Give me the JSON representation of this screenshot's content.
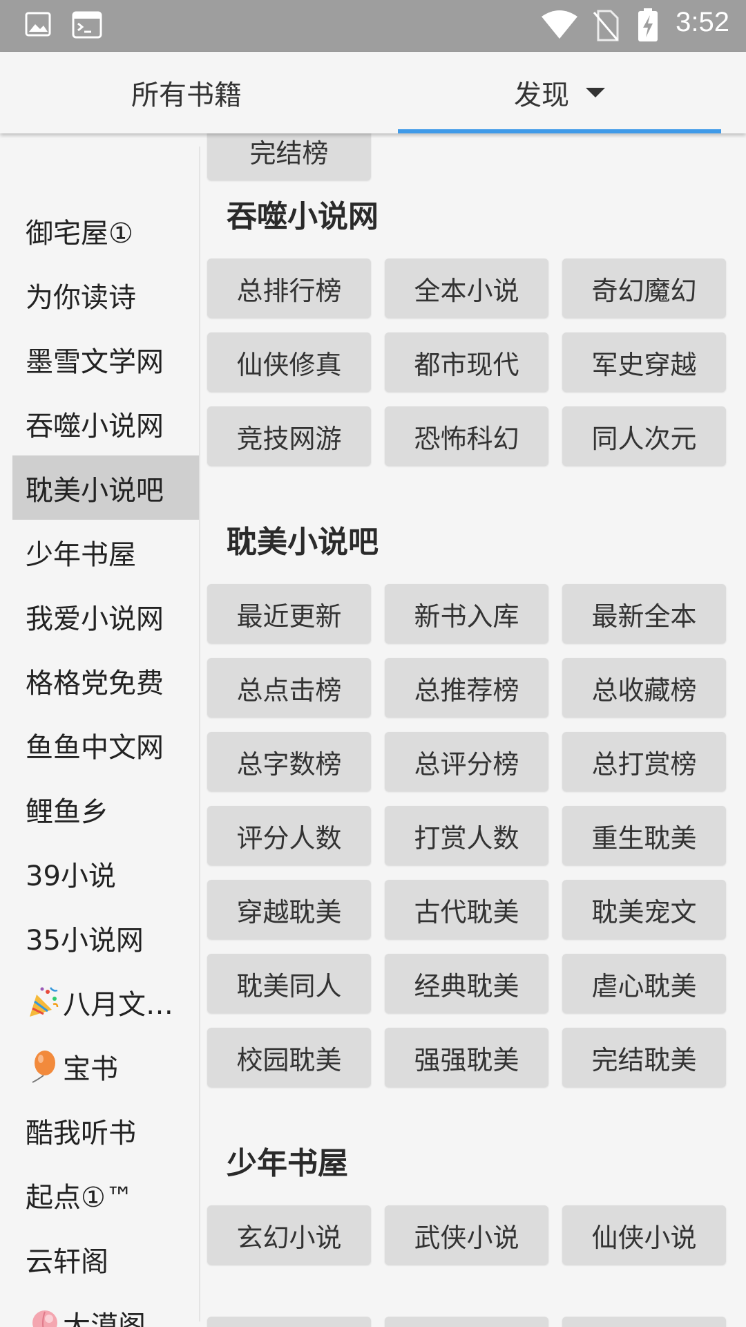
{
  "status_bar": {
    "time": "3:52",
    "icons_left": [
      "image-icon",
      "terminal-icon"
    ],
    "icons_right": [
      "wifi-icon",
      "no-sim-icon",
      "battery-charging-icon"
    ]
  },
  "tabs": {
    "all_books": "所有书籍",
    "discover": "发现",
    "active": "discover"
  },
  "sidebar": {
    "items": [
      {
        "label": "御宅屋①",
        "emoji": ""
      },
      {
        "label": "为你读诗",
        "emoji": ""
      },
      {
        "label": "墨雪文学网",
        "emoji": ""
      },
      {
        "label": "吞噬小说网",
        "emoji": ""
      },
      {
        "label": "耽美小说吧",
        "emoji": "",
        "active": true
      },
      {
        "label": "少年书屋",
        "emoji": ""
      },
      {
        "label": "我爱小说网",
        "emoji": ""
      },
      {
        "label": "格格党免费",
        "emoji": ""
      },
      {
        "label": "鱼鱼中文网",
        "emoji": ""
      },
      {
        "label": "鲤鱼乡",
        "emoji": ""
      },
      {
        "label": "39小说",
        "emoji": ""
      },
      {
        "label": "35小说网",
        "emoji": ""
      },
      {
        "label": "八月文…",
        "emoji": "party-popper-icon"
      },
      {
        "label": "宝书",
        "emoji": "balloon-icon"
      },
      {
        "label": "酷我听书",
        "emoji": ""
      },
      {
        "label": "起点①™",
        "emoji": ""
      },
      {
        "label": "云轩阁",
        "emoji": ""
      },
      {
        "label": "大漠阁",
        "emoji": "peach-icon"
      }
    ]
  },
  "content": {
    "top_button": "完结榜",
    "sections": [
      {
        "title": "吞噬小说网",
        "buttons": [
          "总排行榜",
          "全本小说",
          "奇幻魔幻",
          "仙侠修真",
          "都市现代",
          "军史穿越",
          "竞技网游",
          "恐怖科幻",
          "同人次元"
        ]
      },
      {
        "title": "耽美小说吧",
        "buttons": [
          "最近更新",
          "新书入库",
          "最新全本",
          "总点击榜",
          "总推荐榜",
          "总收藏榜",
          "总字数榜",
          "总评分榜",
          "总打赏榜",
          "评分人数",
          "打赏人数",
          "重生耽美",
          "穿越耽美",
          "古代耽美",
          "耽美宠文",
          "耽美同人",
          "经典耽美",
          "虐心耽美",
          "校园耽美",
          "强强耽美",
          "完结耽美"
        ]
      },
      {
        "title": "少年书屋",
        "buttons": [
          "玄幻小说",
          "武侠小说",
          "仙侠小说"
        ]
      }
    ]
  },
  "colors": {
    "status_bar": "#9e9e9e",
    "accent": "#3f9ae8",
    "button_bg": "#dcdcdc",
    "active_item": "#cfcfcf",
    "background": "#f5f5f5"
  }
}
